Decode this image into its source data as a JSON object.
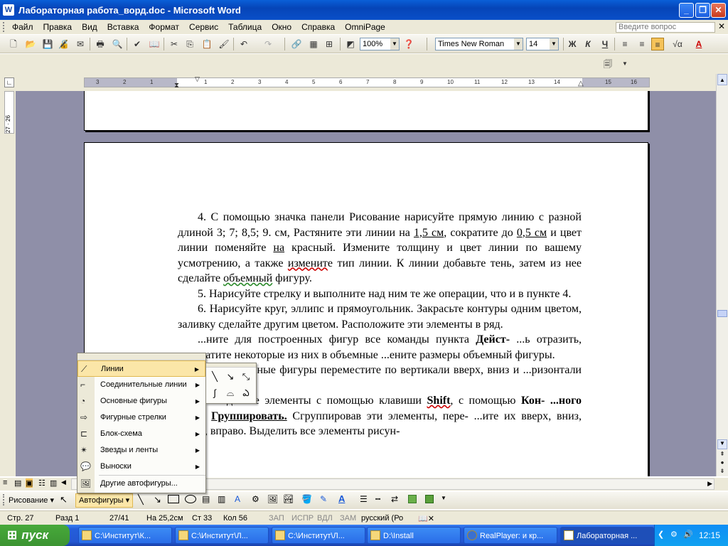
{
  "window": {
    "title": "Лабораторная работа_ворд.doc - Microsoft Word"
  },
  "menu": {
    "items": [
      "Файл",
      "Правка",
      "Вид",
      "Вставка",
      "Формат",
      "Сервис",
      "Таблица",
      "Окно",
      "Справка",
      "OmniPage"
    ],
    "help_placeholder": "Введите вопрос"
  },
  "toolbar": {
    "zoom": "100%",
    "font": "Times New Roman",
    "size": "14"
  },
  "ruler": {
    "ticks": [
      "3",
      "2",
      "1",
      "1",
      "2",
      "3",
      "4",
      "5",
      "6",
      "7",
      "8",
      "9",
      "10",
      "11",
      "12",
      "13",
      "14",
      "15",
      "16",
      "17"
    ]
  },
  "vruler": {
    "ticks": [
      "27",
      "26"
    ]
  },
  "document": {
    "p4a": "4. С помощью значка панели Рисование нарисуйте прямую линию с разной длиной  3; 7; 8,5; 9.  см, Растяните эти линии на ",
    "p4b": "1,5 см",
    "p4c": ", сократите до ",
    "p4d": "0,5 см",
    "p4e": " и цвет линии поменяйте ",
    "p4f": "на",
    "p4g": " красный. Измените толщину и цвет  линии по вашему усмотрению, а также ",
    "p4h": "изменит",
    "p4i": "е тип линии. К линии добавьте тень, затем из нее сделайте ",
    "p4j": "объемный",
    "p4k": " фигуру.",
    "p5": "5. Нарисуйте стрелку и выполните над ним те же операции, что и в пункте 4.",
    "p6": "6. Нарисуйте круг, эллипс и прямоугольник. Закрасьте контуры одним цветом, заливку сделайте другим цветом. Расположите эти элементы в ряд.",
    "p7a": "...ните для построенных фигур все команды пункта ",
    "p7b": "Дейст-",
    "p7c": "...ь отразить, превратите некоторые из них в объемные ...ените размеры объемный фигуры.",
    "p8": "... Построенные фигуры переместите по вертикали вверх, вниз и ...ризонтали влево, вправо.",
    "p9a": "... Выделите элементы с помощью клавиши ",
    "p9b": "Shift",
    "p9c": ", с помощью ",
    "p9d": "Кон-",
    "p9e": "...ного меню ",
    "p9f": "Группировать.",
    "p9g": " Сгруппировав эти элементы, пере-",
    "p9h": "...ите их вверх, вниз, влево, вправо. Выделить все элементы рисун-"
  },
  "autoshapes_menu": {
    "items": [
      "Линии",
      "Соединительные линии",
      "Основные фигуры",
      "Фигурные стрелки",
      "Блок-схема",
      "Звезды и ленты",
      "Выноски",
      "Другие автофигуры..."
    ]
  },
  "drawbar": {
    "drawing": "Рисование",
    "autoshapes": "Автофигуры"
  },
  "status": {
    "page": "Стр. 27",
    "section": "Разд 1",
    "pages": "27/41",
    "at": "На 25,2см",
    "line": "Ст 33",
    "col": "Кол 56",
    "rec": "ЗАП",
    "trk": "ИСПР",
    "ext": "ВДЛ",
    "ovr": "ЗАМ",
    "lang": "русский (Ро"
  },
  "taskbar": {
    "start": "пуск",
    "tasks": [
      "C:\\Институт\\К...",
      "C:\\Институт\\Л...",
      "C:\\Институт\\Л...",
      "D:\\Install",
      "RealPlayer: и кр...",
      "Лабораторная ..."
    ],
    "clock": "12:15"
  },
  "colors": {
    "title_blue": "#0a5fd8",
    "menu_highlight": "#fbe6a8",
    "taskbar_blue": "#245edb",
    "start_green": "#3c9432"
  }
}
